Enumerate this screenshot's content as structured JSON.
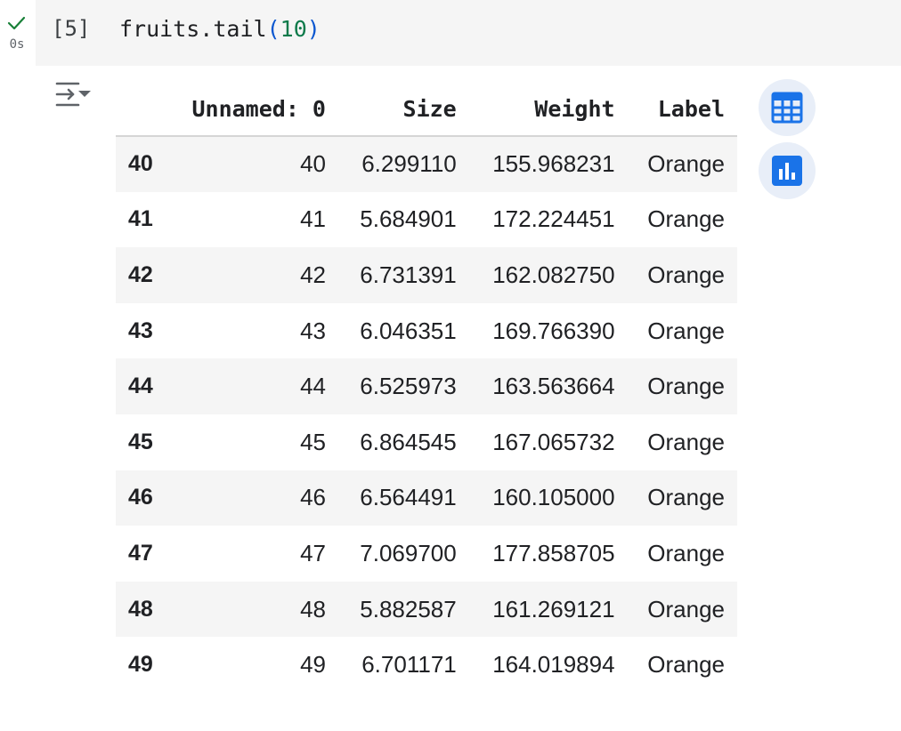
{
  "cell": {
    "exec_time": "0s",
    "exec_count": "[5]",
    "code": {
      "obj": "fruits.tail",
      "open": "(",
      "arg": "10",
      "close": ")"
    }
  },
  "output": {
    "columns": [
      "",
      "Unnamed: 0",
      "Size",
      "Weight",
      "Label"
    ],
    "rows": [
      {
        "index": "40",
        "unnamed": "40",
        "size": "6.299110",
        "weight": "155.968231",
        "label": "Orange"
      },
      {
        "index": "41",
        "unnamed": "41",
        "size": "5.684901",
        "weight": "172.224451",
        "label": "Orange"
      },
      {
        "index": "42",
        "unnamed": "42",
        "size": "6.731391",
        "weight": "162.082750",
        "label": "Orange"
      },
      {
        "index": "43",
        "unnamed": "43",
        "size": "6.046351",
        "weight": "169.766390",
        "label": "Orange"
      },
      {
        "index": "44",
        "unnamed": "44",
        "size": "6.525973",
        "weight": "163.563664",
        "label": "Orange"
      },
      {
        "index": "45",
        "unnamed": "45",
        "size": "6.864545",
        "weight": "167.065732",
        "label": "Orange"
      },
      {
        "index": "46",
        "unnamed": "46",
        "size": "6.564491",
        "weight": "160.105000",
        "label": "Orange"
      },
      {
        "index": "47",
        "unnamed": "47",
        "size": "7.069700",
        "weight": "177.858705",
        "label": "Orange"
      },
      {
        "index": "48",
        "unnamed": "48",
        "size": "5.882587",
        "weight": "161.269121",
        "label": "Orange"
      },
      {
        "index": "49",
        "unnamed": "49",
        "size": "6.701171",
        "weight": "164.019894",
        "label": "Orange"
      }
    ]
  },
  "icons": {
    "status": "check-icon",
    "toggle": "output-toggle-icon",
    "table_button": "table-icon",
    "chart_button": "bar-chart-icon"
  },
  "colors": {
    "success": "#188038",
    "accent": "#1a73e8",
    "button_bg": "#e8eef8",
    "stripe": "#f5f5f5"
  }
}
